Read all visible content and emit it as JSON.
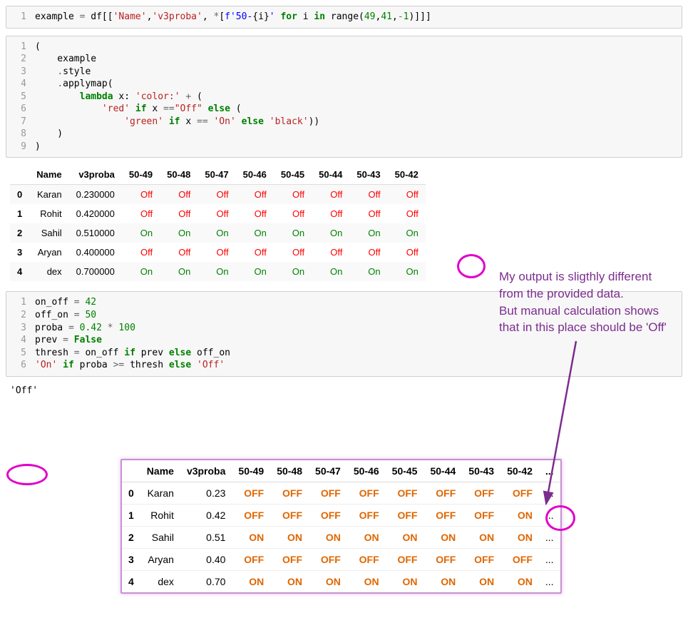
{
  "cell1": {
    "lineno": [
      "1"
    ],
    "code_html": "example <span class=\"op\">=</span> df[[<span class=\"str\">'Name'</span>,<span class=\"str\">'v3proba'</span>, <span class=\"op\">*</span>[<span class=\"str2\">f'50-</span>{i}<span class=\"str2\">'</span> <span class=\"kw\">for</span> i <span class=\"kw\">in</span> range(<span class=\"num\">49</span>,<span class=\"num\">41</span>,<span class=\"op\">-</span><span class=\"num\">1</span>)]]]"
  },
  "cell2": {
    "lineno": [
      "1",
      "2",
      "3",
      "4",
      "5",
      "6",
      "7",
      "8",
      "9"
    ],
    "code_html": "(\n    example\n    <span class=\"op\">.</span>style\n    <span class=\"op\">.</span>applymap(\n        <span class=\"kw\">lambda</span> x: <span class=\"str\">'color:'</span> <span class=\"op\">+</span> (\n            <span class=\"str\">'red'</span> <span class=\"kw\">if</span> x <span class=\"op\">==</span><span class=\"str\">\"Off\"</span> <span class=\"kw\">else</span> (\n                <span class=\"str\">'green'</span> <span class=\"kw\">if</span> x <span class=\"op\">==</span> <span class=\"str\">'On'</span> <span class=\"kw\">else</span> <span class=\"str\">'black'</span>))\n    )\n)"
  },
  "styled_table": {
    "columns": [
      "",
      "Name",
      "v3proba",
      "50-49",
      "50-48",
      "50-47",
      "50-46",
      "50-45",
      "50-44",
      "50-43",
      "50-42"
    ],
    "rows": [
      {
        "idx": "0",
        "name": "Karan",
        "proba": "0.230000",
        "cells": [
          "Off",
          "Off",
          "Off",
          "Off",
          "Off",
          "Off",
          "Off",
          "Off"
        ]
      },
      {
        "idx": "1",
        "name": "Rohit",
        "proba": "0.420000",
        "cells": [
          "Off",
          "Off",
          "Off",
          "Off",
          "Off",
          "Off",
          "Off",
          "Off"
        ]
      },
      {
        "idx": "2",
        "name": "Sahil",
        "proba": "0.510000",
        "cells": [
          "On",
          "On",
          "On",
          "On",
          "On",
          "On",
          "On",
          "On"
        ]
      },
      {
        "idx": "3",
        "name": "Aryan",
        "proba": "0.400000",
        "cells": [
          "Off",
          "Off",
          "Off",
          "Off",
          "Off",
          "Off",
          "Off",
          "Off"
        ]
      },
      {
        "idx": "4",
        "name": "dex",
        "proba": "0.700000",
        "cells": [
          "On",
          "On",
          "On",
          "On",
          "On",
          "On",
          "On",
          "On"
        ]
      }
    ]
  },
  "cell3": {
    "lineno": [
      "1",
      "2",
      "3",
      "4",
      "5",
      "6"
    ],
    "code_html": "on_off <span class=\"op\">=</span> <span class=\"num\">42</span>\noff_on <span class=\"op\">=</span> <span class=\"num\">50</span>\nproba <span class=\"op\">=</span> <span class=\"num\">0.42</span> <span class=\"op\">*</span> <span class=\"num\">100</span>\nprev <span class=\"op\">=</span> <span class=\"kw\">False</span>\nthresh <span class=\"op\">=</span> on_off <span class=\"kw\">if</span> prev <span class=\"kw\">else</span> off_on\n<span class=\"str\">'On'</span> <span class=\"kw\">if</span> proba <span class=\"op\">&gt;=</span> thresh <span class=\"kw\">else</span> <span class=\"str\">'Off'</span>"
  },
  "cell3_output": "'Off'",
  "inset_table": {
    "columns": [
      "",
      "Name",
      "v3proba",
      "50-49",
      "50-48",
      "50-47",
      "50-46",
      "50-45",
      "50-44",
      "50-43",
      "50-42",
      "..."
    ],
    "rows": [
      {
        "idx": "0",
        "name": "Karan",
        "proba": "0.23",
        "cells": [
          "OFF",
          "OFF",
          "OFF",
          "OFF",
          "OFF",
          "OFF",
          "OFF",
          "OFF"
        ],
        "dots": "..."
      },
      {
        "idx": "1",
        "name": "Rohit",
        "proba": "0.42",
        "cells": [
          "OFF",
          "OFF",
          "OFF",
          "OFF",
          "OFF",
          "OFF",
          "OFF",
          "ON"
        ],
        "dots": "..."
      },
      {
        "idx": "2",
        "name": "Sahil",
        "proba": "0.51",
        "cells": [
          "ON",
          "ON",
          "ON",
          "ON",
          "ON",
          "ON",
          "ON",
          "ON"
        ],
        "dots": "..."
      },
      {
        "idx": "3",
        "name": "Aryan",
        "proba": "0.40",
        "cells": [
          "OFF",
          "OFF",
          "OFF",
          "OFF",
          "OFF",
          "OFF",
          "OFF",
          "OFF"
        ],
        "dots": "..."
      },
      {
        "idx": "4",
        "name": "dex",
        "proba": "0.70",
        "cells": [
          "ON",
          "ON",
          "ON",
          "ON",
          "ON",
          "ON",
          "ON",
          "ON"
        ],
        "dots": "..."
      }
    ]
  },
  "annotation": {
    "line1": "My output is sligthly different",
    "line2": "from the provided data.",
    "line3": "But manual calculation shows",
    "line4": "that in this place should be 'Off'"
  }
}
